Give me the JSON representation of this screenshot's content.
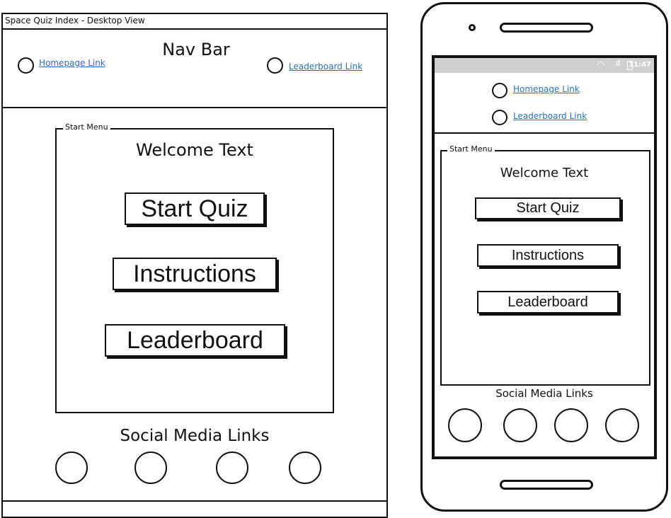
{
  "desktop": {
    "window_title": "Space Quiz Index - Desktop View",
    "nav": {
      "title": "Nav Bar",
      "homepage_link": "Homepage Link",
      "leaderboard_link": "Leaderboard Link"
    },
    "start_menu": {
      "legend": "Start Menu",
      "welcome": "Welcome Text",
      "buttons": [
        "Start Quiz",
        "Instructions",
        "Leaderboard"
      ]
    },
    "social": {
      "label": "Social Media Links",
      "icon_count": 4
    }
  },
  "mobile": {
    "status_bar": {
      "time": "11:47"
    },
    "nav": {
      "homepage_link": "Homepage Link",
      "leaderboard_link": "Leaderboard Link"
    },
    "start_menu": {
      "legend": "Start Menu",
      "welcome": "Welcome Text",
      "buttons": [
        "Start Quiz",
        "Instructions",
        "Leaderboard"
      ]
    },
    "social": {
      "label": "Social Media Links",
      "icon_count": 4
    }
  },
  "colors": {
    "link": "#1f6fd1",
    "ink": "#111111",
    "status_bar": "#d0d0d0"
  }
}
